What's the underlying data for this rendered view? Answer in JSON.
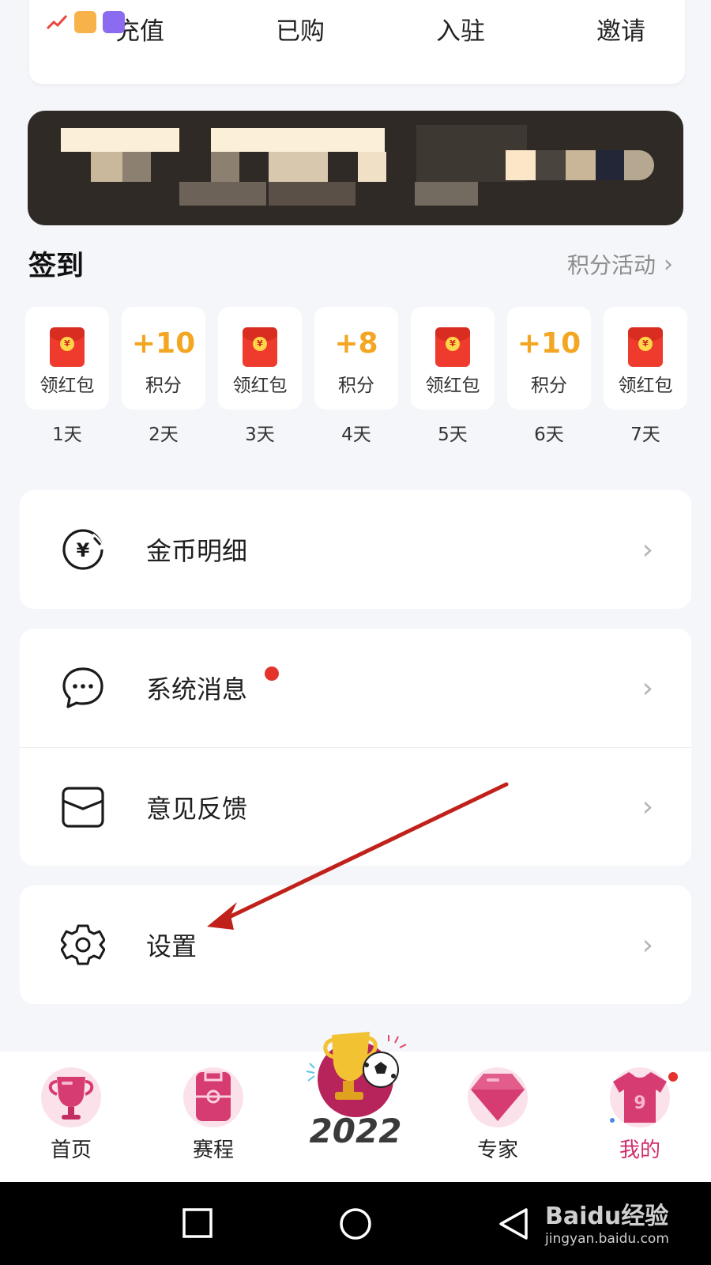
{
  "quick_actions": [
    {
      "label": "充值"
    },
    {
      "label": "已购"
    },
    {
      "label": "入驻"
    },
    {
      "label": "邀请"
    }
  ],
  "signin": {
    "title": "签到",
    "more_label": "积分活动",
    "days": [
      {
        "reward_type": "redpack",
        "reward_label": "领红包",
        "day": "1天"
      },
      {
        "reward_type": "points",
        "points": "+10",
        "reward_label": "积分",
        "day": "2天"
      },
      {
        "reward_type": "redpack",
        "reward_label": "领红包",
        "day": "3天"
      },
      {
        "reward_type": "points",
        "points": "+8",
        "reward_label": "积分",
        "day": "4天"
      },
      {
        "reward_type": "redpack",
        "reward_label": "领红包",
        "day": "5天"
      },
      {
        "reward_type": "points",
        "points": "+10",
        "reward_label": "积分",
        "day": "6天"
      },
      {
        "reward_type": "redpack",
        "reward_label": "领红包",
        "day": "7天"
      }
    ]
  },
  "menu": {
    "coin_detail": {
      "label": "金币明细",
      "icon": "yuan-coin-icon"
    },
    "system_messages": {
      "label": "系统消息",
      "icon": "chat-bubble-icon",
      "has_unread": true
    },
    "feedback": {
      "label": "意见反馈",
      "icon": "envelope-icon"
    },
    "settings": {
      "label": "设置",
      "icon": "gear-icon"
    }
  },
  "tabbar": {
    "items": [
      {
        "label": "首页",
        "icon": "trophy-icon"
      },
      {
        "label": "赛程",
        "icon": "pitch-icon"
      },
      {
        "label": "2022",
        "icon": "world-cup-logo"
      },
      {
        "label": "专家",
        "icon": "diamond-icon"
      },
      {
        "label": "我的",
        "icon": "jersey-icon",
        "active": true
      }
    ]
  },
  "watermark": {
    "main": "Baidu经验",
    "sub": "jingyan.baidu.com"
  },
  "colors": {
    "accent": "#d12d6d",
    "points": "#f3a622",
    "redpack": "#ee3b2e",
    "unread_dot": "#e3332b",
    "annotation_arrow": "#c0211a"
  }
}
